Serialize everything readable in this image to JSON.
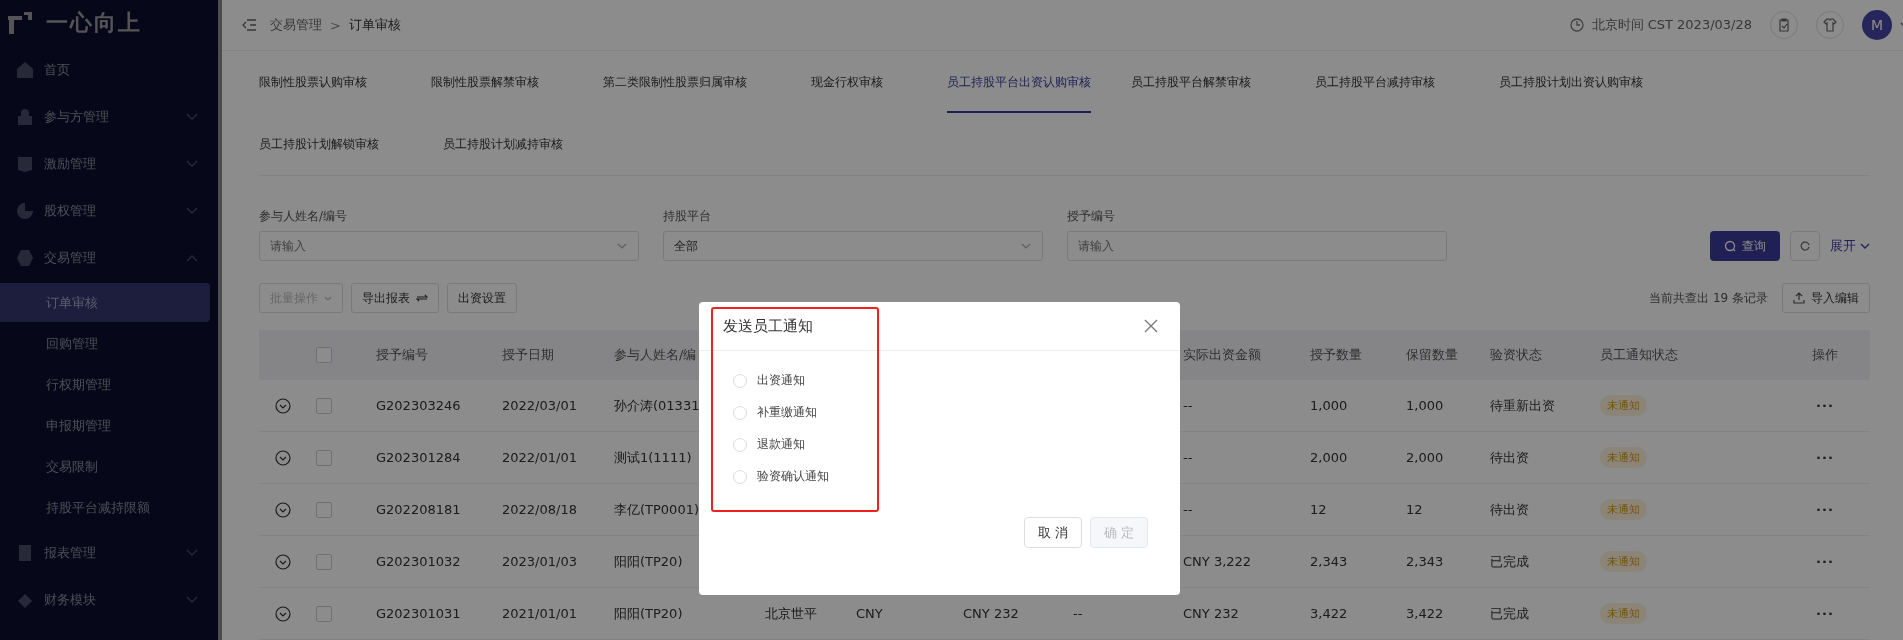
{
  "sidebar": {
    "logo": "一心向上",
    "items": [
      {
        "label": "首页"
      },
      {
        "label": "参与方管理",
        "expanded": false
      },
      {
        "label": "激励管理",
        "expanded": false
      },
      {
        "label": "股权管理",
        "expanded": false
      },
      {
        "label": "交易管理",
        "expanded": true,
        "children": [
          {
            "label": "订单审核",
            "selected": true
          },
          {
            "label": "回购管理",
            "selected": false
          },
          {
            "label": "行权期管理",
            "selected": false
          },
          {
            "label": "申报期管理",
            "selected": false
          },
          {
            "label": "交易限制",
            "selected": false
          },
          {
            "label": "持股平台减持限额",
            "selected": false
          }
        ]
      },
      {
        "label": "报表管理",
        "expanded": false
      },
      {
        "label": "财务模块",
        "expanded": false
      }
    ]
  },
  "header": {
    "breadcrumb": [
      "交易管理",
      "订单审核"
    ],
    "separator": ">",
    "time": "北京时间 CST 2023/03/28",
    "avatar": "M"
  },
  "tabs": [
    {
      "label": "限制性股票认购审核",
      "selected": false
    },
    {
      "label": "限制性股票解禁审核",
      "selected": false
    },
    {
      "label": "第二类限制性股票归属审核",
      "selected": false
    },
    {
      "label": "现金行权审核",
      "selected": false
    },
    {
      "label": "员工持股平台出资认购审核",
      "selected": true
    },
    {
      "label": "员工持股平台解禁审核",
      "selected": false
    },
    {
      "label": "员工持股平台减持审核",
      "selected": false
    },
    {
      "label": "员工持股计划出资认购审核",
      "selected": false
    },
    {
      "label": "员工持股计划解锁审核",
      "selected": false
    },
    {
      "label": "员工持股计划减持审核",
      "selected": false
    }
  ],
  "filters": [
    {
      "label": "参与人姓名/编号",
      "kind": "select",
      "placeholder": "请输入"
    },
    {
      "label": "持股平台",
      "kind": "select",
      "value": "全部"
    },
    {
      "label": "授予编号",
      "kind": "input",
      "placeholder": "请输入"
    }
  ],
  "filter_actions": {
    "search": "查询",
    "expand": "展开"
  },
  "toolbar": {
    "buttons": [
      {
        "label": "批量操作",
        "kind": "dropdown",
        "disabled": true
      },
      {
        "label": "导出报表",
        "kind": "export",
        "disabled": false
      },
      {
        "label": "出资设置",
        "kind": "plain",
        "disabled": false
      }
    ],
    "record_count": "当前共查出 19 条记录",
    "import": "导入编辑"
  },
  "table": {
    "all_checked": false,
    "columns": [
      "授予编号",
      "授予日期",
      "参与人姓名/编",
      "实际出资金额",
      "授予数量",
      "保留数量",
      "验资状态",
      "员工通知状态",
      "操作"
    ],
    "rows": [
      {
        "checked": false,
        "grant_no": "G202303246",
        "grant_date": "2022/03/01",
        "participant": "孙介涛(01331",
        "actual_amount": "--",
        "grant_qty": "1,000",
        "reserved_qty": "1,000",
        "verify_status": "待重新出资",
        "notice_status": "未通知",
        "actions": "···"
      },
      {
        "checked": false,
        "grant_no": "G202301284",
        "grant_date": "2022/01/01",
        "participant": "测试1(1111)",
        "actual_amount": "--",
        "grant_qty": "2,000",
        "reserved_qty": "2,000",
        "verify_status": "待出资",
        "notice_status": "未通知",
        "actions": "···"
      },
      {
        "checked": false,
        "grant_no": "G202208181",
        "grant_date": "2022/08/18",
        "participant": "李亿(TP0001)",
        "actual_amount": "--",
        "grant_qty": "12",
        "reserved_qty": "12",
        "verify_status": "待出资",
        "notice_status": "未通知",
        "actions": "···"
      },
      {
        "checked": false,
        "grant_no": "G202301032",
        "grant_date": "2023/01/03",
        "participant": "阳阳(TP20)",
        "actual_amount": "CNY 3,222",
        "grant_qty": "2,343",
        "reserved_qty": "2,343",
        "verify_status": "已完成",
        "notice_status": "未通知",
        "actions": "···"
      },
      {
        "checked": false,
        "grant_no": "G202301031",
        "grant_date": "2021/01/01",
        "participant": "阳阳(TP20)",
        "column_6": "北京世平",
        "column_7": "CNY",
        "column_8": "CNY 232",
        "column_9": "--",
        "actual_amount": "CNY 232",
        "grant_qty": "3,422",
        "reserved_qty": "3,422",
        "verify_status": "已完成",
        "notice_status": "未通知",
        "actions": "···"
      }
    ]
  },
  "dialog": {
    "title": "发送员工通知",
    "options": [
      {
        "label": "出资通知",
        "selected": false
      },
      {
        "label": "补重缴通知",
        "selected": false
      },
      {
        "label": "退款通知",
        "selected": false
      },
      {
        "label": "验资确认通知",
        "selected": false
      }
    ],
    "buttons": [
      {
        "label": "取 消",
        "disabled": false
      },
      {
        "label": "确 定",
        "disabled": true
      }
    ]
  }
}
